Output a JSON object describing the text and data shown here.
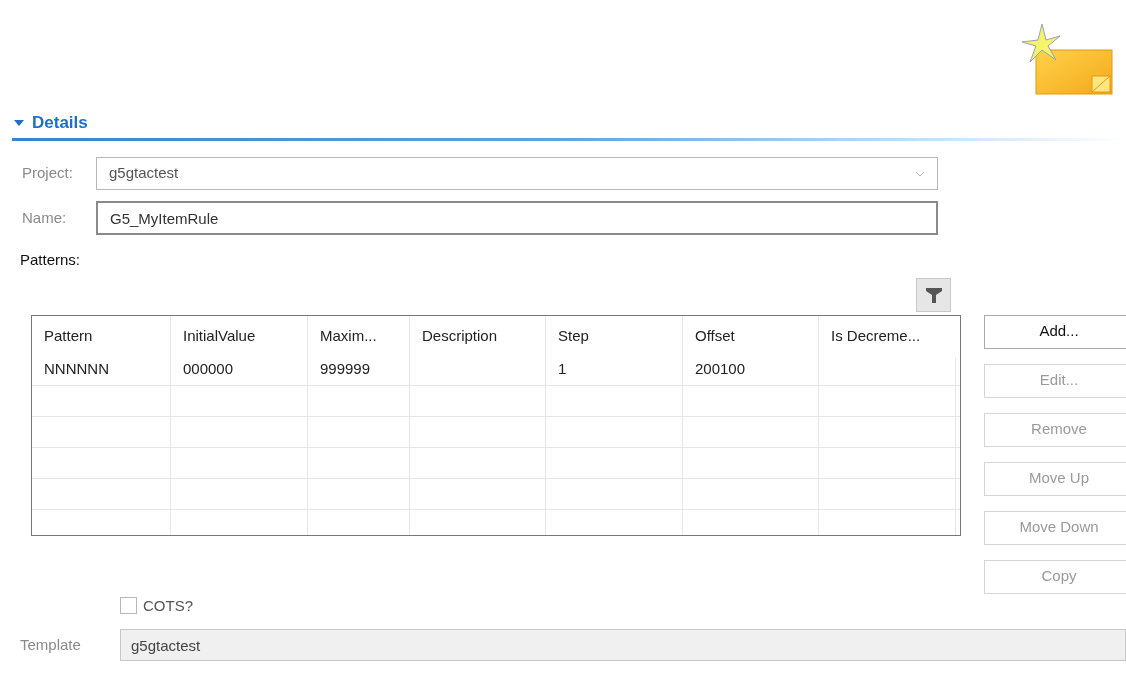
{
  "section": {
    "title": "Details",
    "expanded": true
  },
  "project": {
    "label": "Project:",
    "value": "g5gtactest",
    "disabled": true
  },
  "name": {
    "label": "Name:",
    "value": "G5_MyItemRule"
  },
  "patterns": {
    "label": "Patterns:",
    "table": {
      "columns": [
        "Pattern",
        "InitialValue",
        "Maxim...",
        "Description",
        "Step",
        "Offset",
        "Is Decreme..."
      ],
      "rows": [
        [
          "NNNNNN",
          "000000",
          "999999",
          "",
          "1",
          "200100",
          ""
        ]
      ]
    }
  },
  "buttons": [
    {
      "label": "Add...",
      "disabled": false
    },
    {
      "label": "Edit...",
      "disabled": true
    },
    {
      "label": "Remove",
      "disabled": true
    },
    {
      "label": "Move Up",
      "disabled": true
    },
    {
      "label": "Move Down",
      "disabled": true
    },
    {
      "label": "Copy",
      "disabled": true
    }
  ],
  "cots": {
    "label": "COTS?",
    "checked": false
  },
  "template": {
    "label": "Template",
    "value": "g5gtactest",
    "disabled": true
  }
}
